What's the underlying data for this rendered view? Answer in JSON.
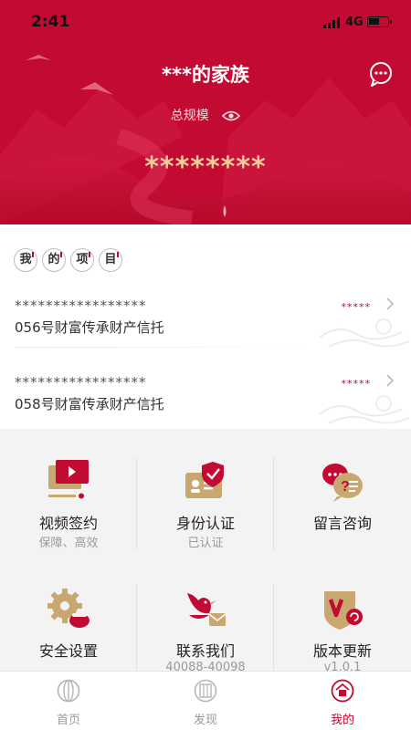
{
  "status_bar": {
    "time": "2:41",
    "network": "4G"
  },
  "header": {
    "title": "***的家族",
    "scale_label": "总规模",
    "amount": "********"
  },
  "projects": {
    "chips": [
      "我",
      "的",
      "项",
      "目"
    ],
    "items": [
      {
        "masked": "*****************",
        "name": "056号财富传承财产信托",
        "tag": "*****"
      },
      {
        "masked": "*****************",
        "name": "058号财富传承财产信托",
        "tag": "*****"
      }
    ]
  },
  "services": [
    {
      "label": "视频签约",
      "sub": "保障、高效",
      "icon": "video-sign-icon"
    },
    {
      "label": "身份认证",
      "sub": "已认证",
      "icon": "id-verify-icon"
    },
    {
      "label": "留言咨询",
      "sub": "",
      "icon": "message-consult-icon"
    },
    {
      "label": "安全设置",
      "sub": "",
      "icon": "security-gear-icon"
    },
    {
      "label": "联系我们",
      "sub": "40088-40098",
      "icon": "contact-bird-icon"
    },
    {
      "label": "版本更新",
      "sub": "v1.0.1",
      "icon": "version-update-icon"
    }
  ],
  "tabbar": {
    "tabs": [
      {
        "label": "首页",
        "icon": "home-icon",
        "active": false
      },
      {
        "label": "发现",
        "icon": "discover-icon",
        "active": false
      },
      {
        "label": "我的",
        "icon": "mine-icon",
        "active": true
      }
    ]
  },
  "colors": {
    "brand_red": "#c20a32",
    "gold": "#c9a770",
    "amount_gold": "#f0cd98"
  }
}
